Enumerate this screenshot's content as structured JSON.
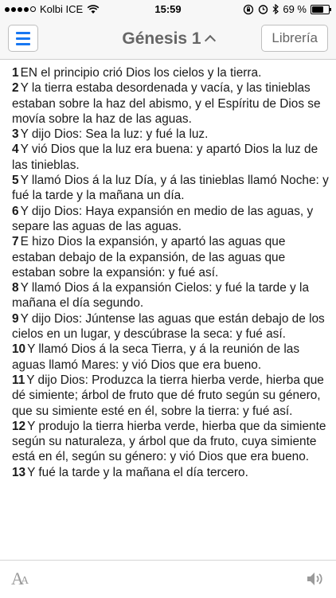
{
  "status_bar": {
    "carrier": "Kolbi ICE",
    "time": "15:59",
    "battery_percent": "69 %",
    "battery_level": 0.69
  },
  "nav": {
    "title": "Génesis 1",
    "library_label": "Librería"
  },
  "verses": [
    {
      "num": "1",
      "text": "EN el principio crió Dios los cielos y la tierra."
    },
    {
      "num": "2",
      "text": "Y la tierra estaba desordenada y vacía, y las tinieblas estaban sobre la haz del abismo, y el Espíritu de Dios se movía sobre la haz de las aguas."
    },
    {
      "num": "3",
      "text": "Y dijo Dios: Sea la luz: y fué la luz."
    },
    {
      "num": "4",
      "text": "Y vió Dios que la luz era buena: y apartó Dios la luz de las tinieblas."
    },
    {
      "num": "5",
      "text": "Y llamó Dios á la luz Día, y á las tinieblas llamó Noche: y fué la tarde y la mañana un día."
    },
    {
      "num": "6",
      "text": "Y dijo Dios: Haya expansión en medio de las aguas, y separe las aguas de las aguas."
    },
    {
      "num": "7",
      "text": "E hizo Dios la expansión, y apartó las aguas que estaban debajo de la expansión, de las aguas que estaban sobre la expansión: y fué así."
    },
    {
      "num": "8",
      "text": "Y llamó Dios á la expansión Cielos: y fué la tarde y la mañana el día segundo."
    },
    {
      "num": "9",
      "text": "Y dijo Dios: Júntense las aguas que están debajo de los cielos en un lugar, y descúbrase la seca: y fué así."
    },
    {
      "num": "10",
      "text": "Y llamó Dios á la seca Tierra, y á la reunión de las aguas llamó Mares: y vió Dios que era bueno."
    },
    {
      "num": "11",
      "text": "Y dijo Dios: Produzca la tierra hierba verde, hierba que dé simiente; árbol de fruto que dé fruto según su género, que su simiente esté en él, sobre la tierra: y fué así."
    },
    {
      "num": "12",
      "text": "Y produjo la tierra hierba verde, hierba que da simiente según su naturaleza, y árbol que da fruto, cuya simiente está en él, según su género: y vió Dios que era bueno."
    },
    {
      "num": "13",
      "text": "Y fué la tarde y la mañana el día tercero."
    }
  ],
  "toolbar": {
    "font_icon_letter": "A",
    "font_icon": "font-size-icon",
    "speaker_icon": "speaker-icon"
  },
  "colors": {
    "accent": "#1877f2",
    "nav_text": "#666666"
  }
}
